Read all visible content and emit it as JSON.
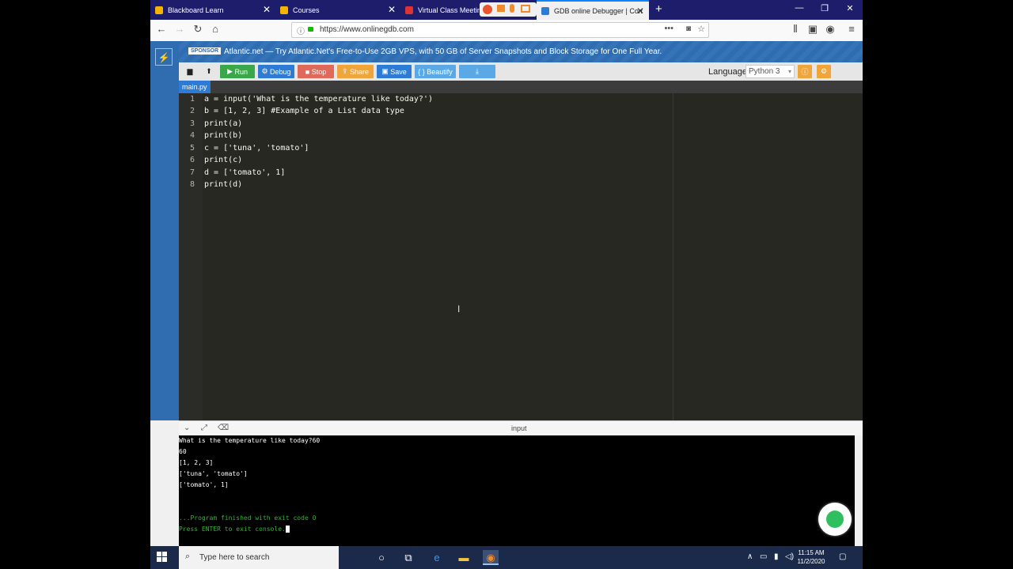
{
  "colors": {
    "tabbar": "#1d1d6b",
    "sponsor": "#2f6db0",
    "run": "#3aa84a",
    "debug": "#2e7bd6",
    "stop": "#e06a5a",
    "share": "#f0a53b",
    "save": "#2e7bd6",
    "beautify": "#5aa8e6",
    "editor_bg": "#272822"
  },
  "browser": {
    "tabs": [
      {
        "label": "Blackboard Learn",
        "icon": "blackboard-icon"
      },
      {
        "label": "Courses",
        "icon": "blackboard-icon"
      },
      {
        "label": "Virtual Class Meeting",
        "icon": "webex-icon"
      },
      {
        "label": "GDB online Debugger | Compi",
        "icon": "gdb-icon"
      }
    ],
    "url": "https://www.onlinegdb.com"
  },
  "sponsor": {
    "tag": "SPONSOR",
    "text": "Atlantic.net — Try Atlantic.Net's Free-to-Use 2GB VPS, with 50 GB of Server Snapshots and Block Storage for One Full Year."
  },
  "toolbar": {
    "run": "Run",
    "debug": "Debug",
    "stop": "Stop",
    "share": "Share",
    "save": "Save",
    "beautify": "{ } Beautify",
    "language_label": "Language",
    "language_value": "Python 3"
  },
  "file_tab": "main.py",
  "code_lines": [
    {
      "n": "1",
      "text": "a = input('What is the temperature like today?')"
    },
    {
      "n": "2",
      "text": "b = [1, 2, 3] #Example of a List data type"
    },
    {
      "n": "3",
      "text": "print(a)"
    },
    {
      "n": "4",
      "text": "print(b)"
    },
    {
      "n": "5",
      "text": "c = ['tuna', 'tomato']"
    },
    {
      "n": "6",
      "text": "print(c)"
    },
    {
      "n": "7",
      "text": "d = ['tomato', 1]"
    },
    {
      "n": "8",
      "text": "print(d)"
    }
  ],
  "console": {
    "header_label": "input",
    "lines": [
      "What is the temperature like today?60",
      "60",
      "[1, 2, 3]",
      "['tuna', 'tomato']",
      "['tomato', 1]",
      "",
      "",
      "...Program finished with exit code 0",
      "Press ENTER to exit console."
    ]
  },
  "taskbar": {
    "search_placeholder": "Type here to search",
    "time": "11:15 AM",
    "date": "11/2/2020"
  }
}
